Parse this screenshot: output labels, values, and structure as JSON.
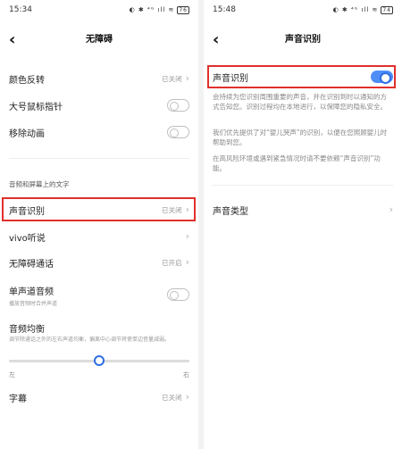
{
  "left": {
    "status": {
      "time": "15:34",
      "icons": "◐ ✱ ⁴ᴳ ıll ≋",
      "battery": "76"
    },
    "title": "无障碍",
    "rows": {
      "color_invert": {
        "label": "颜色反转",
        "value": "已关闭"
      },
      "large_pointer": {
        "label": "大号鼠标指针"
      },
      "remove_anim": {
        "label": "移除动画"
      },
      "section_audio": "音频和屏幕上的文字",
      "sound_recog": {
        "label": "声音识别",
        "value": "已关闭"
      },
      "vivo_listen": {
        "label": "vivo听说"
      },
      "access_call": {
        "label": "无障碍通话",
        "value": "已开启"
      },
      "mono_audio": {
        "label": "单声道音频",
        "sub": "播放音频时合并声道"
      },
      "audio_balance": {
        "label": "音频均衡",
        "sub": "调节除通话之外的左右声道均衡，偏离中心调节将使单边音量减弱。"
      },
      "left_label": "左",
      "right_label": "右",
      "captions": {
        "label": "字幕",
        "value": "已关闭"
      }
    },
    "balance_level": 0.5
  },
  "right": {
    "status": {
      "time": "15:48",
      "icons": "◐ ✱ ⁴ᴳ ıll ≋",
      "battery": "74"
    },
    "title": "声音识别",
    "toggle_label": "声音识别",
    "toggle_on": true,
    "desc1": "会持续为您识别周围重要的声音，并在识别到时以通知的方式告知您。识别过程均在本地进行，以保障您的隐私安全。",
    "desc2": "我们优先提供了对“婴儿哭声”的识别，以便在您照顾婴儿时帮助到您。",
    "desc3": "在高风险环境或遇到紧急情况时请不要依赖“声音识别”功能。",
    "sound_types": "声音类型"
  },
  "colors": {
    "highlight": "#e0302c",
    "accent": "#2f6fe4"
  }
}
